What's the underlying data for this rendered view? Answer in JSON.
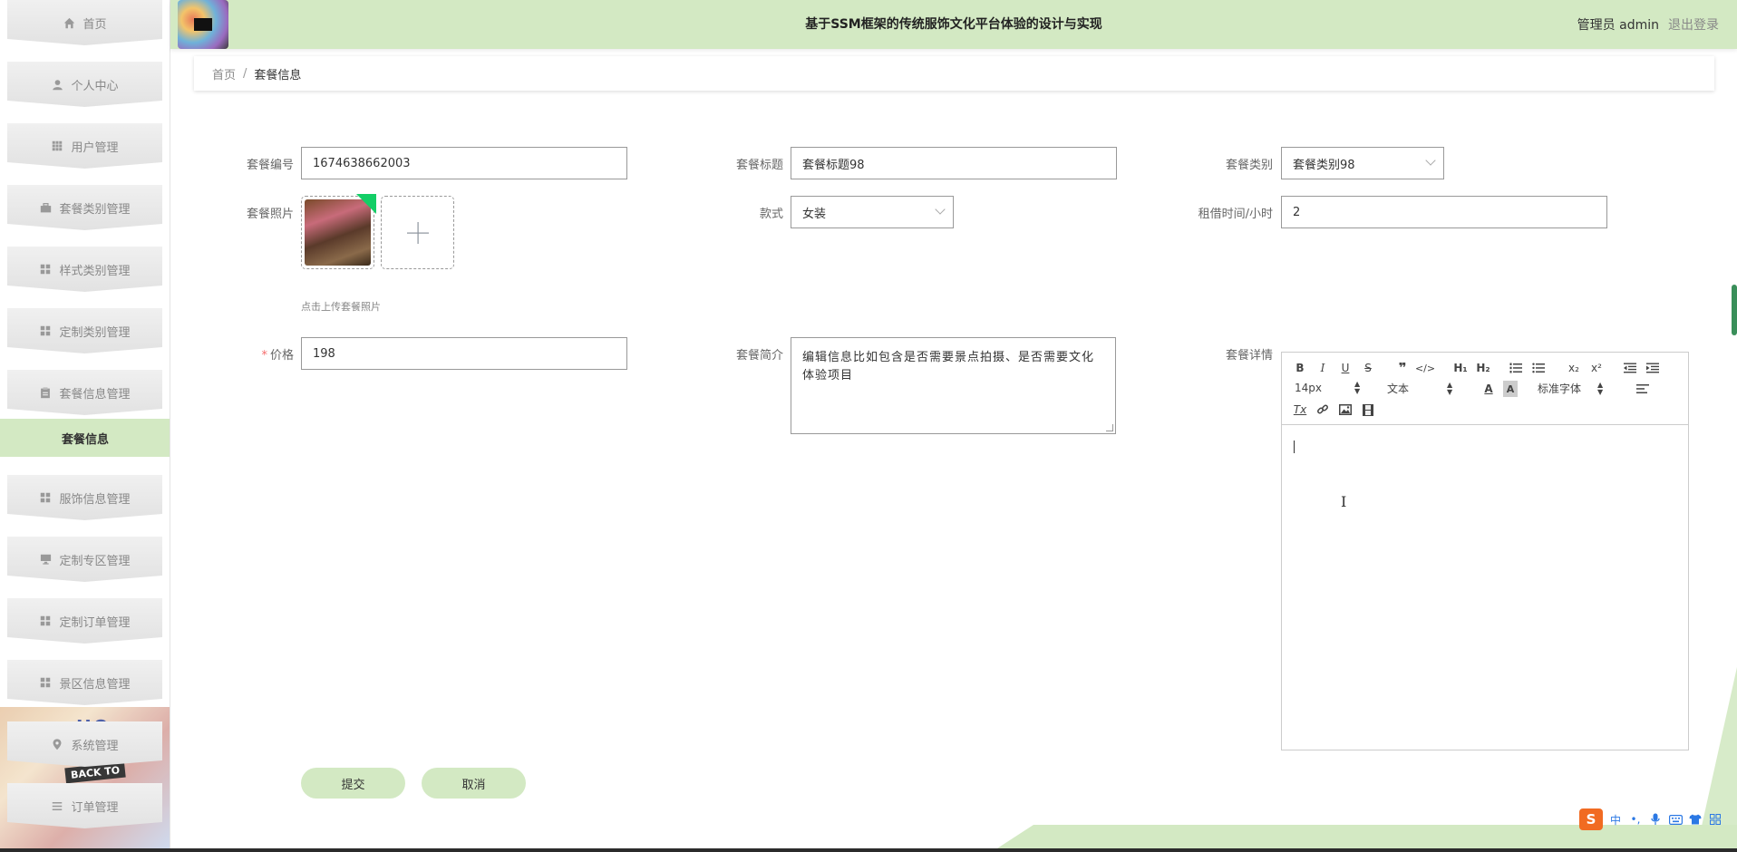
{
  "sidebar": {
    "items": [
      {
        "label": "首页",
        "icon": "home-icon"
      },
      {
        "label": "个人中心",
        "icon": "user-icon"
      },
      {
        "label": "用户管理",
        "icon": "grid-icon"
      },
      {
        "label": "套餐类别管理",
        "icon": "briefcase-icon"
      },
      {
        "label": "样式类别管理",
        "icon": "grid-icon"
      },
      {
        "label": "定制类别管理",
        "icon": "grid-icon"
      },
      {
        "label": "套餐信息管理",
        "icon": "clipboard-icon"
      },
      {
        "label": "服饰信息管理",
        "icon": "grid-icon"
      },
      {
        "label": "定制专区管理",
        "icon": "monitor-icon"
      },
      {
        "label": "定制订单管理",
        "icon": "grid-icon"
      },
      {
        "label": "景区信息管理",
        "icon": "grid-icon"
      },
      {
        "label": "系统管理",
        "icon": "location-icon"
      },
      {
        "label": "订单管理",
        "icon": "list-icon"
      }
    ],
    "active_sub": "套餐信息",
    "deco_text": "HO",
    "deco_badge": "BACK TO"
  },
  "header": {
    "title": "基于SSM框架的传统服饰文化平台体验的设计与实现",
    "user": "管理员 admin",
    "logout": "退出登录"
  },
  "breadcrumb": {
    "home": "首页",
    "separator": "/",
    "current": "套餐信息"
  },
  "form": {
    "code_label": "套餐编号",
    "code_value": "1674638662003",
    "title_label": "套餐标题",
    "title_value": "套餐标题98",
    "category_label": "套餐类别",
    "category_value": "套餐类别98",
    "photo_label": "套餐照片",
    "photo_tip": "点击上传套餐照片",
    "style_label": "款式",
    "style_value": "女装",
    "rent_label": "租借时间/小时",
    "rent_value": "2",
    "price_label": "价格",
    "price_required": "*",
    "price_value": "198",
    "intro_label": "套餐简介",
    "intro_value": "编辑信息比如包含是否需要景点拍摄、是否需要文化体验项目",
    "detail_label": "套餐详情"
  },
  "editor": {
    "font_size": "14px",
    "paragraph": "文本",
    "font_family": "标准字体"
  },
  "buttons": {
    "submit": "提交",
    "cancel": "取消"
  },
  "ime": {
    "logo": "S",
    "mode": "中"
  },
  "colors": {
    "accent": "#d3e9c3",
    "upload_success": "#13ce66",
    "required": "#f56c6c"
  }
}
